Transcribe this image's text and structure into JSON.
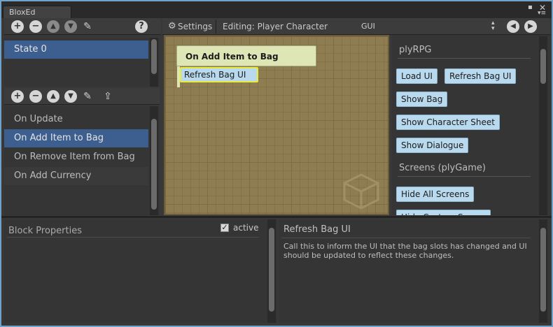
{
  "window": {
    "tab_title": "BloxEd"
  },
  "toolbar": {
    "settings_label": "Settings",
    "editing_label": "Editing: Player Character",
    "context_select": "GUI",
    "help_glyph": "?"
  },
  "states": {
    "items": [
      "State 0"
    ]
  },
  "events": {
    "items": [
      "On Update",
      "On Add Item to Bag",
      "On Remove Item from Bag",
      "On Add Currency"
    ]
  },
  "canvas": {
    "event_block": "On Add Item to Bag",
    "action_block": "Refresh Bag UI"
  },
  "palette": {
    "section1": "plyRPG",
    "section1_blocks": [
      "Load UI",
      "Refresh Bag UI",
      "Show Bag",
      "Show Character Sheet",
      "Show Dialogue"
    ],
    "section2": "Screens (plyGame)",
    "section2_blocks": [
      "Hide All Screens",
      "Hide Custom Screen"
    ]
  },
  "properties": {
    "title": "Block Properties",
    "active_label": "active",
    "active_checked": true
  },
  "help": {
    "title": "Refresh Bag UI",
    "text": "Call this to inform the UI that the bag slots has changed and UI should be updated to reflect these changes."
  },
  "icons": [
    "add-icon",
    "remove-icon",
    "move-up-icon",
    "move-down-icon",
    "edit-icon",
    "help-icon",
    "upload-icon",
    "gear-icon",
    "nav-back-icon",
    "nav-forward-icon",
    "select-arrows-icon",
    "cube-watermark-icon",
    "checkbox-icon"
  ],
  "colors": {
    "selection": "#3d5f8f",
    "event_block": "#dde6b4",
    "action_block": "#b9d9ee",
    "action_outline": "#eaea3a",
    "canvas": "#8f7d52",
    "window_border": "#6fa3c9"
  }
}
